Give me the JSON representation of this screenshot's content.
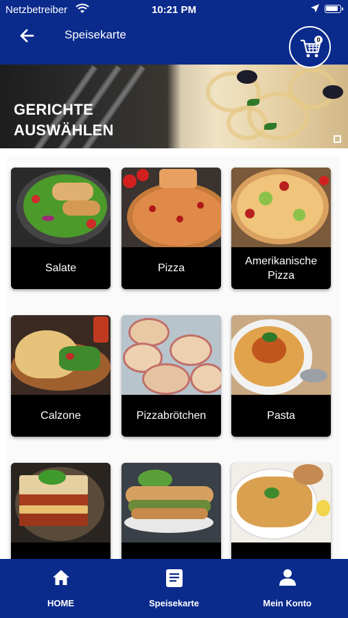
{
  "status_bar": {
    "carrier": "Netzbetreiber",
    "time": "10:21 PM"
  },
  "header": {
    "title": "Speisekarte",
    "cart_count": "0"
  },
  "banner": {
    "line1": "GERICHTE",
    "line2": "AUSWÄHLEN"
  },
  "categories": [
    {
      "label": "Salate"
    },
    {
      "label": "Pizza"
    },
    {
      "label": "Amerikanische Pizza"
    },
    {
      "label": "Calzone"
    },
    {
      "label": "Pizzabrötchen"
    },
    {
      "label": "Pasta"
    },
    {
      "label": ""
    },
    {
      "label": ""
    },
    {
      "label": ""
    }
  ],
  "bottom_nav": [
    {
      "label": "HOME",
      "icon": "home-icon"
    },
    {
      "label": "Speisekarte",
      "icon": "menu-icon"
    },
    {
      "label": "Mein Konto",
      "icon": "user-icon"
    }
  ],
  "colors": {
    "primary": "#0a2a8c",
    "card_label_bg": "#000000",
    "text_on_primary": "#ffffff"
  }
}
